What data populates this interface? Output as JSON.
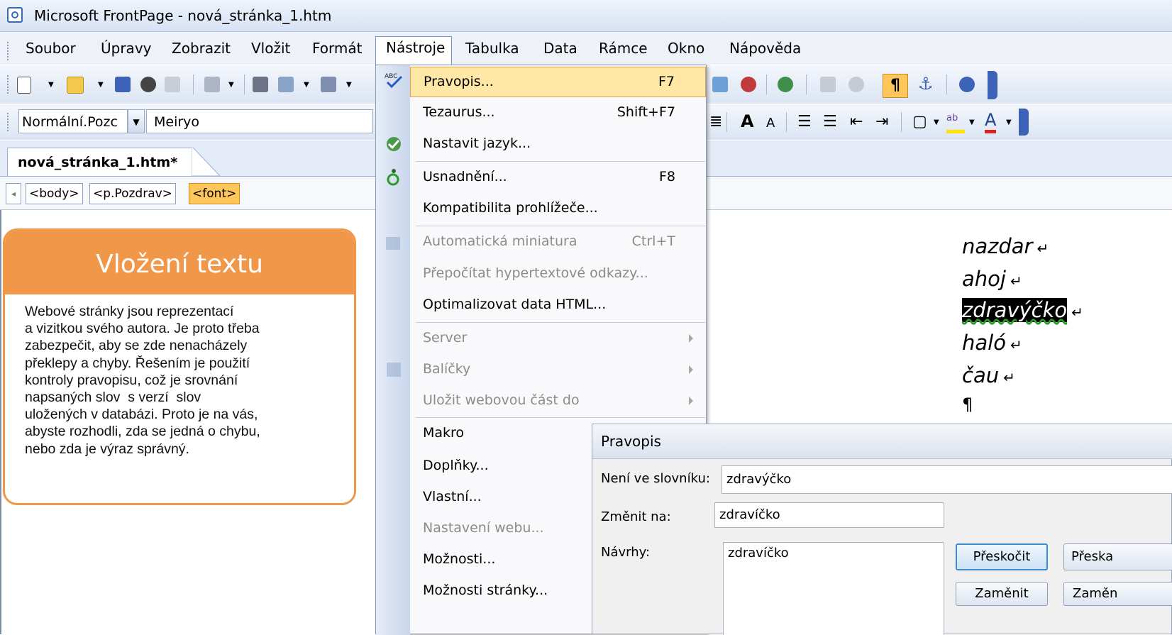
{
  "window": {
    "title": "Microsoft FrontPage - nová_stránka_1.htm"
  },
  "menubar": [
    "Soubor",
    "Úpravy",
    "Zobrazit",
    "Vložit",
    "Formát",
    "Nástroje",
    "Tabulka",
    "Data",
    "Rámce",
    "Okno",
    "Nápověda"
  ],
  "formatting": {
    "style": "Normální.Pozc",
    "font": "Meiryo"
  },
  "doc_tab": "nová_stránka_1.htm*",
  "tagbar": {
    "scroll_left": "◂",
    "tags": [
      "<body>",
      "<p.Pozdrav>",
      "<font>"
    ]
  },
  "document": {
    "words": [
      "nazdar",
      "ahoj",
      "zdravýčko",
      "haló",
      "čau"
    ],
    "return_mark": "↵",
    "pilcrow": "¶"
  },
  "callout": {
    "title": "Vložení textu",
    "lines": [
      "Webové stránky jsou reprezentací",
      "a vizitkou svého autora. Je proto třeba",
      "zabezpečit, aby se zde nenacházely",
      "překlepy a chyby. Řešením je použití",
      "kontroly pravopisu, což je srovnání",
      "napsaných slov  s verzí  slov",
      "uložených v databázi. Proto je na vás,",
      "abyste rozhodli, zda se jedná o chybu,",
      "nebo zda je výraz správný."
    ]
  },
  "tools_menu": [
    {
      "label": "Pravopis...",
      "shortcut": "F7"
    },
    {
      "label": "Tezaurus...",
      "shortcut": "Shift+F7"
    },
    {
      "label": "Nastavit jazyk...",
      "shortcut": ""
    },
    {
      "label": "Usnadnění...",
      "shortcut": "F8"
    },
    {
      "label": "Kompatibilita prohlížeče...",
      "shortcut": ""
    },
    {
      "label": "Automatická miniatura",
      "shortcut": "Ctrl+T"
    },
    {
      "label": "Přepočítat hypertextové odkazy...",
      "shortcut": ""
    },
    {
      "label": "Optimalizovat data HTML...",
      "shortcut": ""
    },
    {
      "label": "Server",
      "shortcut": ""
    },
    {
      "label": "Balíčky",
      "shortcut": ""
    },
    {
      "label": "Uložit webovou část do",
      "shortcut": ""
    },
    {
      "label": "Makro",
      "shortcut": ""
    },
    {
      "label": "Doplňky...",
      "shortcut": ""
    },
    {
      "label": "Vlastní...",
      "shortcut": ""
    },
    {
      "label": "Nastavení webu...",
      "shortcut": ""
    },
    {
      "label": "Možnosti...",
      "shortcut": ""
    },
    {
      "label": "Možnosti stránky...",
      "shortcut": ""
    }
  ],
  "spell_dialog": {
    "title": "Pravopis",
    "not_in_dict_label": "Není ve slovníku:",
    "not_in_dict_value": "zdravýčko",
    "change_to_label": "Změnit na:",
    "change_to_value": "zdravíčko",
    "suggestions_label": "Návrhy:",
    "suggestions": [
      "zdravíčko"
    ],
    "buttons": {
      "skip": "Přeskočit",
      "skip_all": "Přeska",
      "change": "Zaměnit",
      "change_all": "Zaměn"
    }
  },
  "colors": {
    "accent_orange": "#f0974a",
    "menu_highlight": "#ffe8a6",
    "selected_tag": "#ffc75a"
  }
}
